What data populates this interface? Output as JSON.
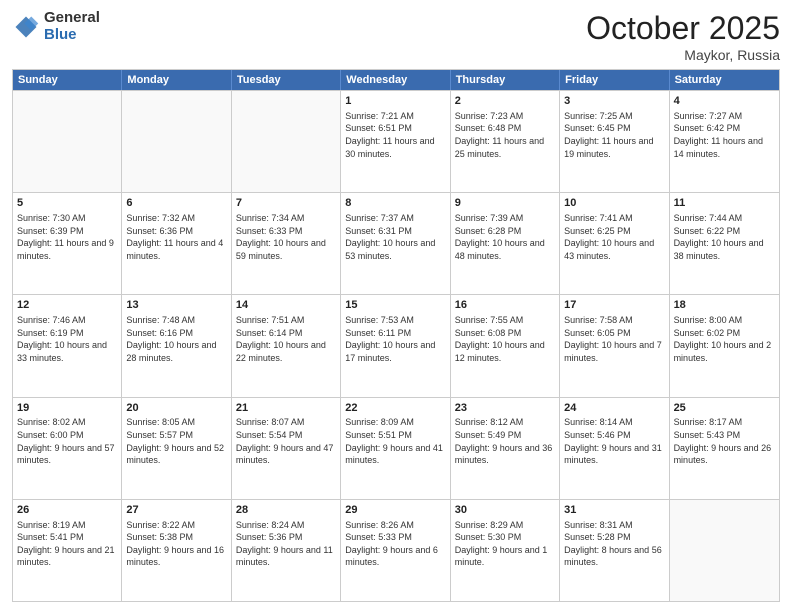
{
  "header": {
    "logo_general": "General",
    "logo_blue": "Blue",
    "month_title": "October 2025",
    "location": "Maykor, Russia"
  },
  "weekdays": [
    "Sunday",
    "Monday",
    "Tuesday",
    "Wednesday",
    "Thursday",
    "Friday",
    "Saturday"
  ],
  "rows": [
    [
      {
        "day": "",
        "sunrise": "",
        "sunset": "",
        "daylight": ""
      },
      {
        "day": "",
        "sunrise": "",
        "sunset": "",
        "daylight": ""
      },
      {
        "day": "",
        "sunrise": "",
        "sunset": "",
        "daylight": ""
      },
      {
        "day": "1",
        "sunrise": "Sunrise: 7:21 AM",
        "sunset": "Sunset: 6:51 PM",
        "daylight": "Daylight: 11 hours and 30 minutes."
      },
      {
        "day": "2",
        "sunrise": "Sunrise: 7:23 AM",
        "sunset": "Sunset: 6:48 PM",
        "daylight": "Daylight: 11 hours and 25 minutes."
      },
      {
        "day": "3",
        "sunrise": "Sunrise: 7:25 AM",
        "sunset": "Sunset: 6:45 PM",
        "daylight": "Daylight: 11 hours and 19 minutes."
      },
      {
        "day": "4",
        "sunrise": "Sunrise: 7:27 AM",
        "sunset": "Sunset: 6:42 PM",
        "daylight": "Daylight: 11 hours and 14 minutes."
      }
    ],
    [
      {
        "day": "5",
        "sunrise": "Sunrise: 7:30 AM",
        "sunset": "Sunset: 6:39 PM",
        "daylight": "Daylight: 11 hours and 9 minutes."
      },
      {
        "day": "6",
        "sunrise": "Sunrise: 7:32 AM",
        "sunset": "Sunset: 6:36 PM",
        "daylight": "Daylight: 11 hours and 4 minutes."
      },
      {
        "day": "7",
        "sunrise": "Sunrise: 7:34 AM",
        "sunset": "Sunset: 6:33 PM",
        "daylight": "Daylight: 10 hours and 59 minutes."
      },
      {
        "day": "8",
        "sunrise": "Sunrise: 7:37 AM",
        "sunset": "Sunset: 6:31 PM",
        "daylight": "Daylight: 10 hours and 53 minutes."
      },
      {
        "day": "9",
        "sunrise": "Sunrise: 7:39 AM",
        "sunset": "Sunset: 6:28 PM",
        "daylight": "Daylight: 10 hours and 48 minutes."
      },
      {
        "day": "10",
        "sunrise": "Sunrise: 7:41 AM",
        "sunset": "Sunset: 6:25 PM",
        "daylight": "Daylight: 10 hours and 43 minutes."
      },
      {
        "day": "11",
        "sunrise": "Sunrise: 7:44 AM",
        "sunset": "Sunset: 6:22 PM",
        "daylight": "Daylight: 10 hours and 38 minutes."
      }
    ],
    [
      {
        "day": "12",
        "sunrise": "Sunrise: 7:46 AM",
        "sunset": "Sunset: 6:19 PM",
        "daylight": "Daylight: 10 hours and 33 minutes."
      },
      {
        "day": "13",
        "sunrise": "Sunrise: 7:48 AM",
        "sunset": "Sunset: 6:16 PM",
        "daylight": "Daylight: 10 hours and 28 minutes."
      },
      {
        "day": "14",
        "sunrise": "Sunrise: 7:51 AM",
        "sunset": "Sunset: 6:14 PM",
        "daylight": "Daylight: 10 hours and 22 minutes."
      },
      {
        "day": "15",
        "sunrise": "Sunrise: 7:53 AM",
        "sunset": "Sunset: 6:11 PM",
        "daylight": "Daylight: 10 hours and 17 minutes."
      },
      {
        "day": "16",
        "sunrise": "Sunrise: 7:55 AM",
        "sunset": "Sunset: 6:08 PM",
        "daylight": "Daylight: 10 hours and 12 minutes."
      },
      {
        "day": "17",
        "sunrise": "Sunrise: 7:58 AM",
        "sunset": "Sunset: 6:05 PM",
        "daylight": "Daylight: 10 hours and 7 minutes."
      },
      {
        "day": "18",
        "sunrise": "Sunrise: 8:00 AM",
        "sunset": "Sunset: 6:02 PM",
        "daylight": "Daylight: 10 hours and 2 minutes."
      }
    ],
    [
      {
        "day": "19",
        "sunrise": "Sunrise: 8:02 AM",
        "sunset": "Sunset: 6:00 PM",
        "daylight": "Daylight: 9 hours and 57 minutes."
      },
      {
        "day": "20",
        "sunrise": "Sunrise: 8:05 AM",
        "sunset": "Sunset: 5:57 PM",
        "daylight": "Daylight: 9 hours and 52 minutes."
      },
      {
        "day": "21",
        "sunrise": "Sunrise: 8:07 AM",
        "sunset": "Sunset: 5:54 PM",
        "daylight": "Daylight: 9 hours and 47 minutes."
      },
      {
        "day": "22",
        "sunrise": "Sunrise: 8:09 AM",
        "sunset": "Sunset: 5:51 PM",
        "daylight": "Daylight: 9 hours and 41 minutes."
      },
      {
        "day": "23",
        "sunrise": "Sunrise: 8:12 AM",
        "sunset": "Sunset: 5:49 PM",
        "daylight": "Daylight: 9 hours and 36 minutes."
      },
      {
        "day": "24",
        "sunrise": "Sunrise: 8:14 AM",
        "sunset": "Sunset: 5:46 PM",
        "daylight": "Daylight: 9 hours and 31 minutes."
      },
      {
        "day": "25",
        "sunrise": "Sunrise: 8:17 AM",
        "sunset": "Sunset: 5:43 PM",
        "daylight": "Daylight: 9 hours and 26 minutes."
      }
    ],
    [
      {
        "day": "26",
        "sunrise": "Sunrise: 8:19 AM",
        "sunset": "Sunset: 5:41 PM",
        "daylight": "Daylight: 9 hours and 21 minutes."
      },
      {
        "day": "27",
        "sunrise": "Sunrise: 8:22 AM",
        "sunset": "Sunset: 5:38 PM",
        "daylight": "Daylight: 9 hours and 16 minutes."
      },
      {
        "day": "28",
        "sunrise": "Sunrise: 8:24 AM",
        "sunset": "Sunset: 5:36 PM",
        "daylight": "Daylight: 9 hours and 11 minutes."
      },
      {
        "day": "29",
        "sunrise": "Sunrise: 8:26 AM",
        "sunset": "Sunset: 5:33 PM",
        "daylight": "Daylight: 9 hours and 6 minutes."
      },
      {
        "day": "30",
        "sunrise": "Sunrise: 8:29 AM",
        "sunset": "Sunset: 5:30 PM",
        "daylight": "Daylight: 9 hours and 1 minute."
      },
      {
        "day": "31",
        "sunrise": "Sunrise: 8:31 AM",
        "sunset": "Sunset: 5:28 PM",
        "daylight": "Daylight: 8 hours and 56 minutes."
      },
      {
        "day": "",
        "sunrise": "",
        "sunset": "",
        "daylight": ""
      }
    ]
  ]
}
